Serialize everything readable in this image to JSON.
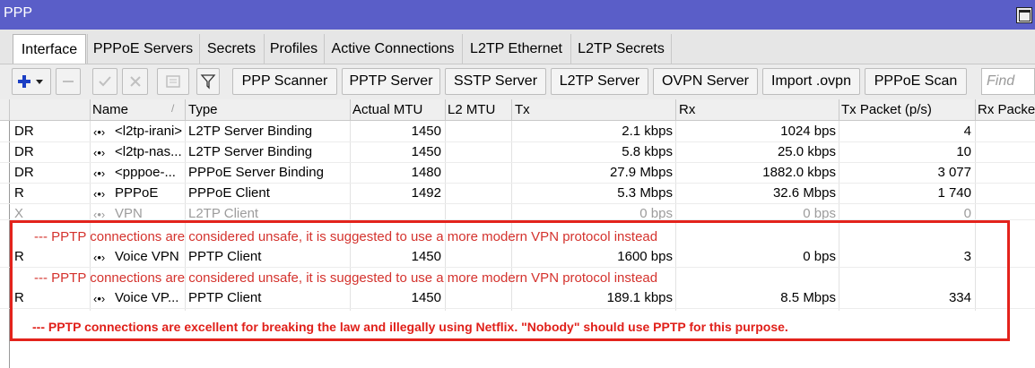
{
  "window": {
    "title": "PPP"
  },
  "tabs": [
    "Interface",
    "PPPoE Servers",
    "Secrets",
    "Profiles",
    "Active Connections",
    "L2TP Ethernet",
    "L2TP Secrets"
  ],
  "toolbar": {
    "add_icon": "plus-icon",
    "remove_icon": "minus-icon",
    "enable_icon": "check-icon",
    "disable_icon": "x-icon",
    "comment_icon": "note-icon",
    "filter_icon": "filter-icon",
    "buttons": [
      "PPP Scanner",
      "PPTP Server",
      "SSTP Server",
      "L2TP Server",
      "OVPN Server",
      "Import .ovpn",
      "PPPoE Scan"
    ],
    "find_placeholder": "Find"
  },
  "table": {
    "columns": [
      "Name",
      "Type",
      "Actual MTU",
      "L2 MTU",
      "Tx",
      "Rx",
      "Tx Packet (p/s)",
      "Rx Packe"
    ],
    "rows": [
      {
        "flags": "DR",
        "name": "<l2tp-irani>",
        "type": "L2TP Server Binding",
        "mtu": "1450",
        "l2mtu": "",
        "tx": "2.1 kbps",
        "rx": "1024 bps",
        "txp": "4"
      },
      {
        "flags": "DR",
        "name": "<l2tp-nas...",
        "type": "L2TP Server Binding",
        "mtu": "1450",
        "l2mtu": "",
        "tx": "5.8 kbps",
        "rx": "25.0 kbps",
        "txp": "10"
      },
      {
        "flags": "DR",
        "name": "<pppoe-...",
        "type": "PPPoE Server Binding",
        "mtu": "1480",
        "l2mtu": "",
        "tx": "27.9 Mbps",
        "rx": "1882.0 kbps",
        "txp": "3 077"
      },
      {
        "flags": "R",
        "name": "PPPoE",
        "type": "PPPoE Client",
        "mtu": "1492",
        "l2mtu": "",
        "tx": "5.3 Mbps",
        "rx": "32.6 Mbps",
        "txp": "1 740"
      },
      {
        "flags": "X",
        "name": "VPN",
        "type": "L2TP Client",
        "mtu": "",
        "l2mtu": "",
        "tx": "0 bps",
        "rx": "0 bps",
        "txp": "0"
      },
      {
        "warning": "--- PPTP connections are considered unsafe, it is suggested to use a more modern VPN protocol instead"
      },
      {
        "flags": "R",
        "name": "Voice VPN",
        "type": "PPTP Client",
        "mtu": "1450",
        "l2mtu": "",
        "tx": "1600 bps",
        "rx": "0 bps",
        "txp": "3"
      },
      {
        "warning": "--- PPTP connections are considered unsafe, it is suggested to use a more modern VPN protocol instead"
      },
      {
        "flags": "R",
        "name": "Voice VP...",
        "type": "PPTP Client",
        "mtu": "1450",
        "l2mtu": "",
        "tx": "189.1 kbps",
        "rx": "8.5 Mbps",
        "txp": "334"
      }
    ],
    "dir_glyph": "‹•›"
  },
  "annotation": {
    "text": "--- PPTP connections are excellent for breaking the law and illegally using Netflix.  \"Nobody\" should use PPTP for this purpose.",
    "color": "#e3231c"
  }
}
